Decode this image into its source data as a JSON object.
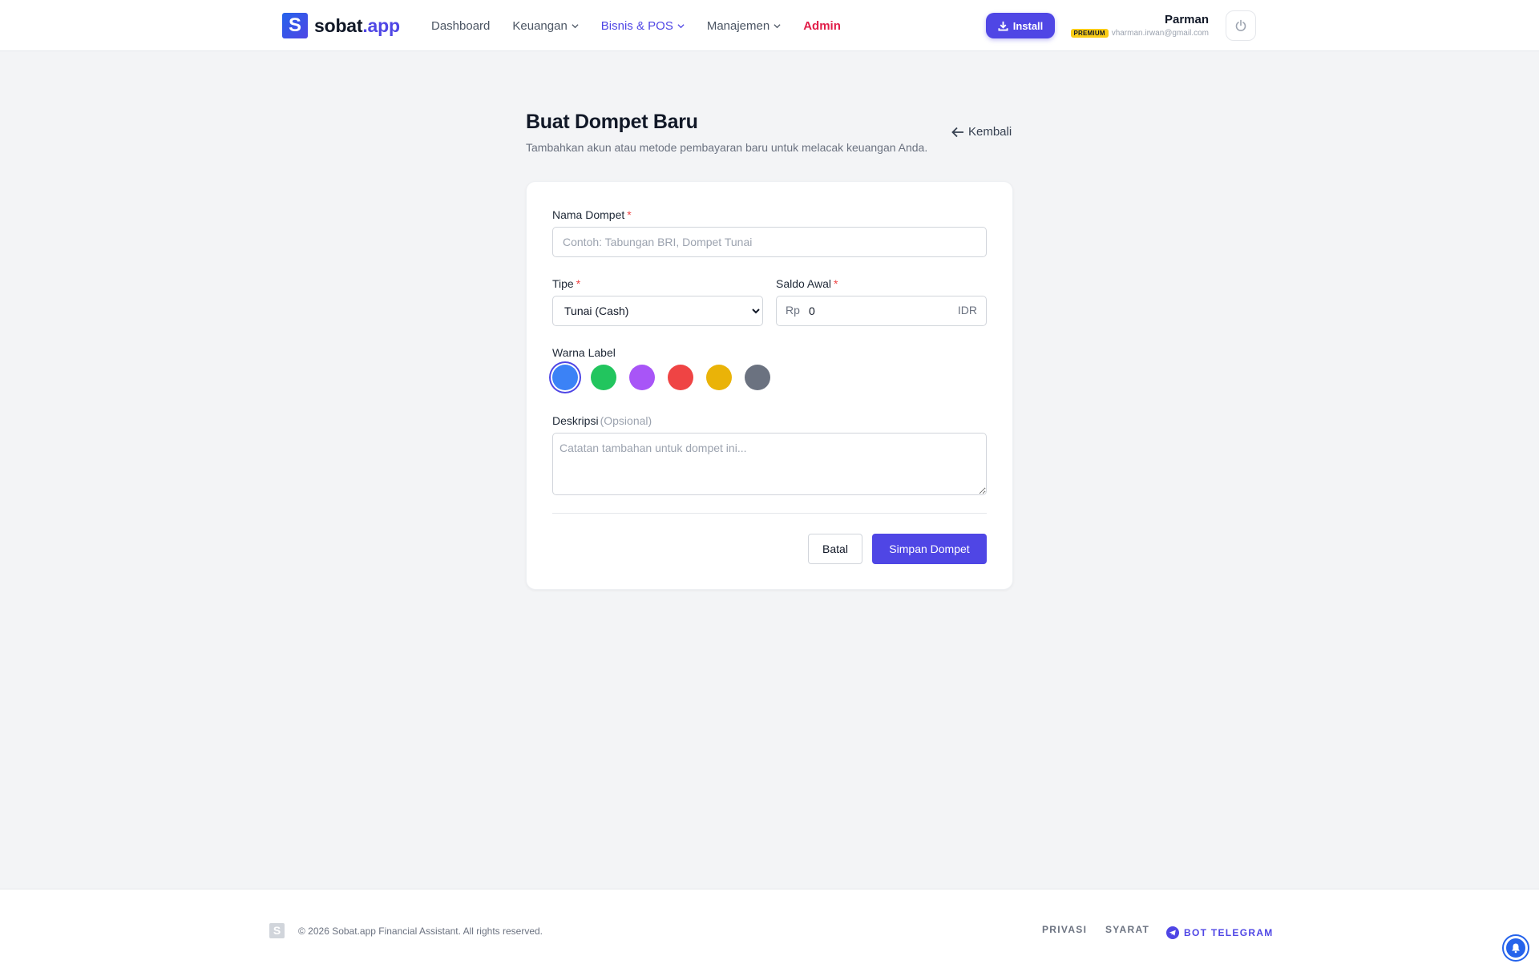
{
  "navbar": {
    "logo_letter": "S",
    "logo_name": "sobat",
    "logo_suffix": ".app",
    "links": [
      {
        "label": "Dashboard"
      },
      {
        "label": "Keuangan"
      },
      {
        "label": "Bisnis & POS"
      },
      {
        "label": "Manajemen"
      },
      {
        "label": "Admin"
      }
    ],
    "install_label": "Install",
    "user_name": "Parman",
    "user_badge": "PREMIUM",
    "user_email": "vharman.irwan@gmail.com"
  },
  "page": {
    "title": "Buat Dompet Baru",
    "subtitle": "Tambahkan akun atau metode pembayaran baru untuk melacak keuangan Anda.",
    "back_label": "Kembali"
  },
  "form": {
    "name_label": "Nama Dompet",
    "name_placeholder": "Contoh: Tabungan BRI, Dompet Tunai",
    "type_label": "Tipe",
    "type_value": "Tunai (Cash)",
    "balance_label": "Saldo Awal",
    "balance_prefix": "Rp",
    "balance_value": "0",
    "balance_suffix": "IDR",
    "required_mark": "*",
    "color_label": "Warna Label",
    "colors": [
      "#3b82f6",
      "#22c55e",
      "#a855f7",
      "#ef4444",
      "#eab308",
      "#6b7280"
    ],
    "selected_color": "#3b82f6",
    "desc_label": "Deskripsi",
    "desc_optional": "(Opsional)",
    "desc_placeholder": "Catatan tambahan untuk dompet ini...",
    "cancel_label": "Batal",
    "save_label": "Simpan Dompet"
  },
  "footer": {
    "logo_letter": "S",
    "copyright": "© 2026 Sobat.app Financial Assistant. All rights reserved.",
    "privacy": "PRIVASI",
    "terms": "SYARAT",
    "telegram": "BOT TELEGRAM"
  },
  "colors": {
    "accent": "#4f46e5",
    "admin": "#e11d48",
    "premium": "#facc15"
  }
}
